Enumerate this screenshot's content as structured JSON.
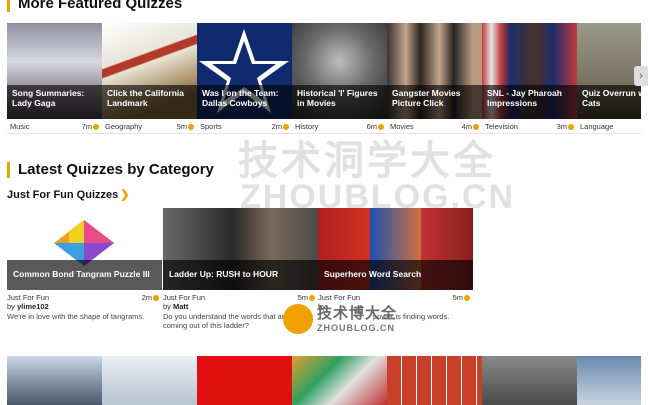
{
  "featured": {
    "title": "More Featured Quizzes",
    "items": [
      {
        "title": "Song Summaries: Lady Gaga",
        "category": "Music",
        "time": "7m",
        "color": "#5a4a5a"
      },
      {
        "title": "Click the California Landmark",
        "category": "Geography",
        "time": "5m",
        "color": "#3a7bb0"
      },
      {
        "title": "Was I on the Team: Dallas Cowboys",
        "category": "Sports",
        "time": "2m",
        "color": "#102a66"
      },
      {
        "title": "Historical 'I' Figures in Movies",
        "category": "History",
        "time": "6m",
        "color": "#555555"
      },
      {
        "title": "Gangster Movies Picture Click",
        "category": "Movies",
        "time": "4m",
        "color": "#2e2a26"
      },
      {
        "title": "SNL - Jay Pharoah Impressions",
        "category": "Television",
        "time": "3m",
        "color": "#3a3c6a"
      },
      {
        "title": "Quiz Overrun with Cats",
        "category": "Language",
        "time": "",
        "color": "#6b6b5e"
      }
    ]
  },
  "latest": {
    "title": "Latest Quizzes by Category",
    "category_heading": "Just For Fun Quizzes",
    "cards": [
      {
        "title": "Common Bond Tangram Puzzle III",
        "category": "Just For Fun",
        "time": "2m",
        "by_prefix": "by",
        "author": "ylime102",
        "desc": "We're in love with the shape of tangrams."
      },
      {
        "title": "Ladder Up: RUSH to HOUR",
        "category": "Just For Fun",
        "time": "5m",
        "by_prefix": "by",
        "author": "Matt",
        "desc": "Do you understand the words that are coming out of this ladder?"
      },
      {
        "title": "Superhero Word Search",
        "category": "Just For Fun",
        "time": "5m",
        "by_prefix": "by",
        "author": "",
        "desc": "power is finding words."
      }
    ]
  },
  "watermark": {
    "cn": "技术洞学大全",
    "en": "ZHOUBLOG.CN",
    "small_cn": "技术博大全",
    "small_en": "ZHOUBLOG.CN"
  }
}
